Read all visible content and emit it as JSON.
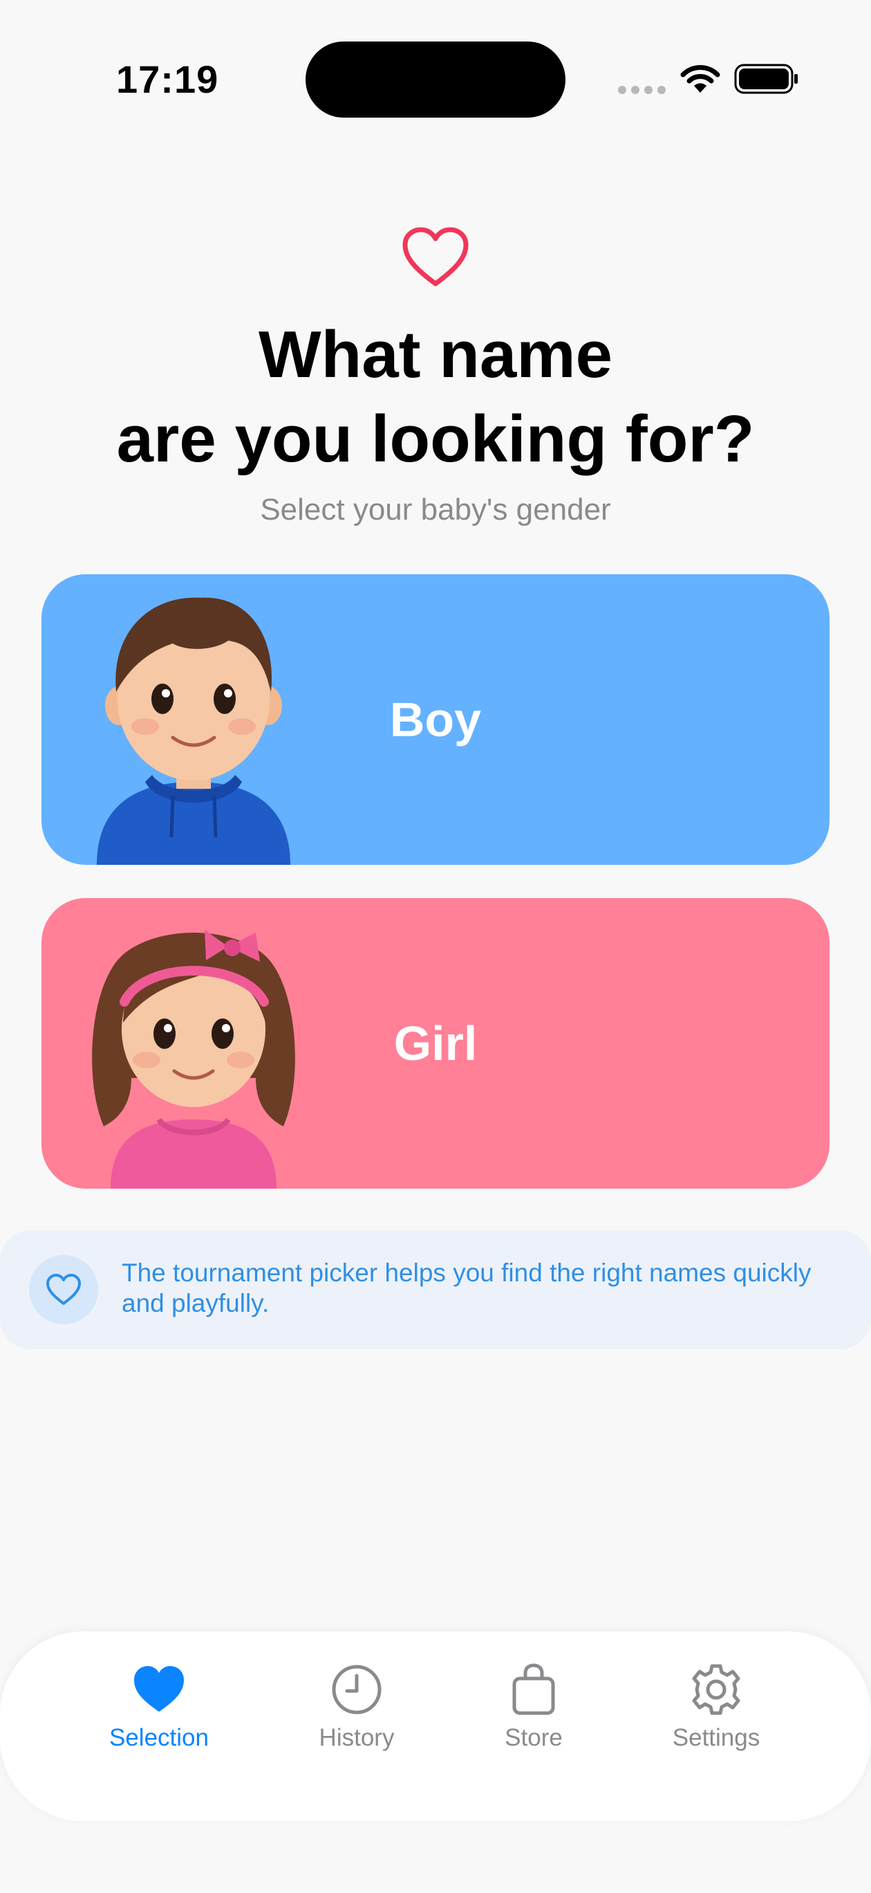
{
  "status_bar": {
    "time": "17:19"
  },
  "header": {
    "icon": "heart-outline-icon",
    "title_line1": "What name",
    "title_line2": "are you looking for?",
    "subtitle": "Select your baby's gender"
  },
  "gender_options": [
    {
      "label": "Boy",
      "color": "#64b1ff",
      "avatar": "boy-avatar"
    },
    {
      "label": "Girl",
      "color": "#ff8097",
      "avatar": "girl-avatar"
    }
  ],
  "tip": {
    "icon": "heart-outline-icon",
    "text": "The tournament picker helps you find the right names quickly and playfully."
  },
  "tabs": [
    {
      "label": "Selection",
      "icon": "heart-icon",
      "active": true
    },
    {
      "label": "History",
      "icon": "clock-icon",
      "active": false
    },
    {
      "label": "Store",
      "icon": "shopping-bag-icon",
      "active": false
    },
    {
      "label": "Settings",
      "icon": "gear-icon",
      "active": false
    }
  ],
  "colors": {
    "accent": "#0a84ff",
    "heart": "#f0375a",
    "boy": "#64b1ff",
    "girl": "#ff8097",
    "tip_text": "#2f8fe4"
  }
}
